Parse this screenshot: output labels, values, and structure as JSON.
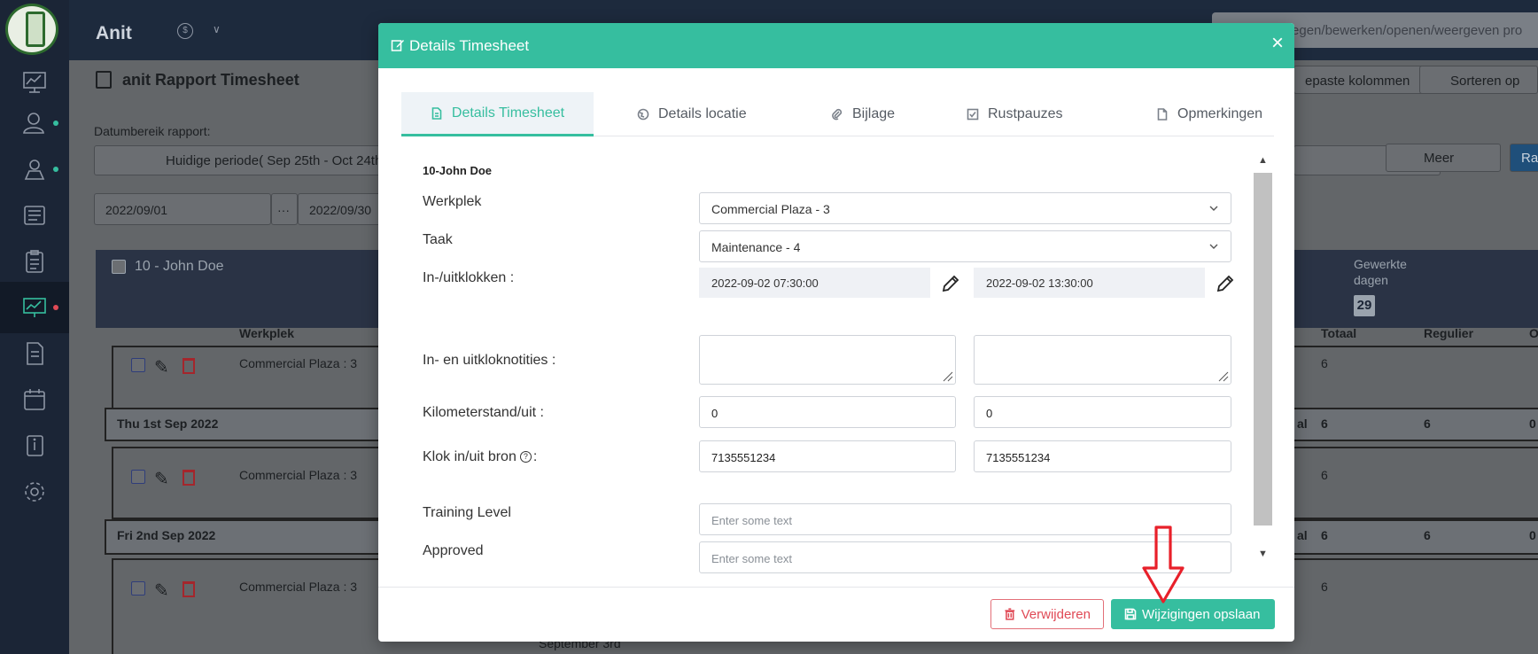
{
  "app": {
    "brand": "Anit",
    "coin_symbol": "$",
    "search_placeholder": "Toevoegen/bewerken/openen/weergeven pro",
    "report_title": "anit Rapport Timesheet",
    "date_range_label": "Datumbereik rapport:",
    "period_value": "Huidige periode( Sep 25th - Oct 24th",
    "date_from": "2022/09/01",
    "date_sep": "···",
    "date_to": "2022/09/30",
    "custom_columns": "epaste kolommen",
    "sort_by": "Sorteren op",
    "more": "Meer",
    "right_btn": "Ra",
    "employee_header": "10 - John Doe",
    "worked_days_label_1": "Gewerkte",
    "worked_days_label_2": "dagen",
    "worked_days_value": "29",
    "col_workplace": "Werkplek",
    "col_total": "Totaal",
    "col_regular": "Regulier",
    "col_o": "O",
    "rows": [
      {
        "workplace": "Commercial Plaza : 3",
        "total": "6",
        "day": "Thu 1st Sep 2022",
        "sum_label": "al",
        "sum_total": "6",
        "sum_regular": "6",
        "sum_o": "0"
      },
      {
        "workplace": "Commercial Plaza : 3",
        "total": "6",
        "day": "Fri 2nd Sep 2022",
        "sum_label": "al",
        "sum_total": "6",
        "sum_regular": "6",
        "sum_o": "0"
      },
      {
        "workplace": "Commercial Plaza : 3",
        "total": "6",
        "day": "September 3rd"
      }
    ]
  },
  "modal": {
    "title": "Details Timesheet",
    "close": "×",
    "tabs": [
      {
        "label": "Details Timesheet",
        "icon": "document-icon"
      },
      {
        "label": "Details locatie",
        "icon": "globe-icon"
      },
      {
        "label": "Bijlage",
        "icon": "paperclip-icon"
      },
      {
        "label": "Rustpauzes",
        "icon": "checkbox-icon"
      },
      {
        "label": "Opmerkingen",
        "icon": "file-icon"
      }
    ],
    "employee": "10-John Doe",
    "fields": {
      "workplace_label": "Werkplek",
      "workplace_value": "Commercial Plaza - 3",
      "task_label": "Taak",
      "task_value": "Maintenance - 4",
      "clock_label": "In-/uitklokken :",
      "clock_in": "2022-09-02 07:30:00",
      "clock_out": "2022-09-02 13:30:00",
      "notes_label": "In- en uitkloknotities :",
      "odometer_label": "Kilometerstand/uit :",
      "odometer_in": "0",
      "odometer_out": "0",
      "source_label": "Klok in/uit bron",
      "source_suffix": ":",
      "help": "?",
      "source_in": "7135551234",
      "source_out": "7135551234",
      "training_label": "Training Level",
      "training_placeholder": "Enter some text",
      "approved_label": "Approved",
      "approved_placeholder": "Enter some text"
    },
    "buttons": {
      "delete": "Verwijderen",
      "save": "Wijzigingen opslaan"
    }
  },
  "colors": {
    "accent": "#36be9f",
    "danger": "#e04a56",
    "sidebar": "#1b2536",
    "arrow": "#e8202a"
  }
}
